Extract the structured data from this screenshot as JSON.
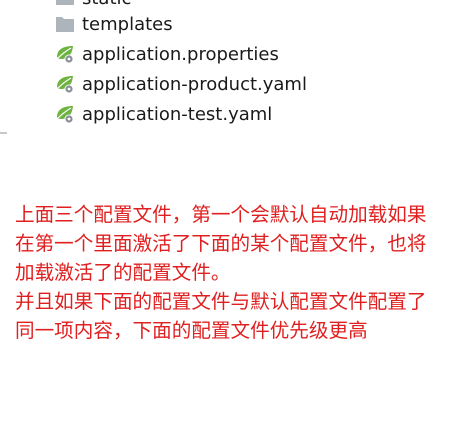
{
  "tree": {
    "items": [
      {
        "label": "static",
        "icon": "folder-icon"
      },
      {
        "label": "templates",
        "icon": "folder-icon"
      },
      {
        "label": "application.properties",
        "icon": "spring-config-icon"
      },
      {
        "label": "application-product.yaml",
        "icon": "spring-config-icon"
      },
      {
        "label": "application-test.yaml",
        "icon": "spring-config-icon"
      }
    ]
  },
  "note": {
    "color": "#e02020",
    "paragraphs": [
      "上面三个配置文件，第一个会默认自动加载如果在第一个里面激活了下面的某个配置文件，也将加载激活了的配置文件。",
      "并且如果下面的配置文件与默认配置文件配置了同一项内容，下面的配置文件优先级更高"
    ]
  }
}
